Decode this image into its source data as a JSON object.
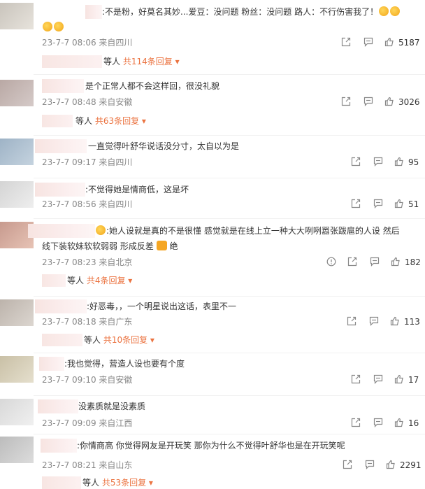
{
  "actions": {
    "share": "share-icon",
    "comment": "comment-icon",
    "like": "like-icon",
    "report": "report-icon"
  },
  "comments": [
    {
      "text": ":不是粉，好莫名其妙...爱豆：没问题  粉丝：没问题 路人：不行伤害我了！",
      "time": "23-7-7 08:06 来自四川",
      "likes": "5187",
      "replies": {
        "suffix": "等人",
        "link": "共114条回复 ▾"
      }
    },
    {
      "text": "是个正常人都不会这样回，很没礼貌",
      "time": "23-7-7 08:48 来自安徽",
      "likes": "3026",
      "replies": {
        "suffix": "等人",
        "link": "共63条回复 ▾"
      }
    },
    {
      "text": "一直觉得叶舒华说话没分寸，太自以为是",
      "time": "23-7-7 09:17 来自四川",
      "likes": "95"
    },
    {
      "text": ":不觉得她是情商低，这是坏",
      "time": "23-7-7 08:56 来自四川",
      "likes": "51"
    },
    {
      "text": ":她人设就是真的不是很懂 感觉就是在线上立一种大大咧咧嚣张跋扈的人设 然后",
      "text2": "线下装软妹软软弱弱 形成反差",
      "text2_tail": "绝",
      "time": "23-7-7 08:23 来自北京",
      "likes": "182",
      "replies": {
        "suffix": "等人",
        "link": "共4条回复 ▾"
      }
    },
    {
      "text": ":好恶毒，，一个明星说出这话，表里不一",
      "time": "23-7-7 08:18 来自广东",
      "likes": "113",
      "replies": {
        "suffix": "等人",
        "link": "共10条回复 ▾"
      }
    },
    {
      "text": ":我也觉得，营造人设也要有个度",
      "time": "23-7-7 09:10 来自安徽",
      "likes": "17"
    },
    {
      "text": "没素质就是没素质",
      "time": "23-7-7 09:09 来自江西",
      "likes": "16"
    },
    {
      "text": ":你情商高 你觉得网友是开玩笑 那你为什么不觉得叶舒华也是在开玩笑呢",
      "time": "23-7-7 08:21 来自山东",
      "likes": "2291",
      "replies": {
        "suffix": "等人",
        "link": "共53条回复 ▾"
      }
    }
  ]
}
